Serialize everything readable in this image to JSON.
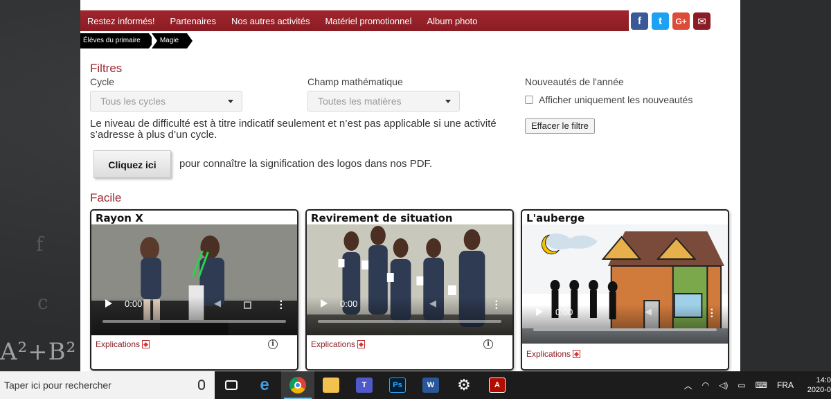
{
  "nav": {
    "items": [
      "Restez informés!",
      "Partenaires",
      "Nos autres activités",
      "Matériel promotionnel",
      "Album photo"
    ]
  },
  "social": {
    "facebook": "f",
    "twitter": "t",
    "google": "G+",
    "mail": "✉"
  },
  "breadcrumb": [
    "Élèves du primaire",
    "Magie"
  ],
  "filters": {
    "title": "Filtres",
    "cycle_label": "Cycle",
    "cycle_value": "Tous les cycles",
    "field_label": "Champ mathématique",
    "field_value": "Toutes les matières",
    "news_label": "Nouveautés de l'année",
    "news_checkbox": "Afficher uniquement les nouveautés",
    "clear_button": "Effacer le filtre",
    "notice": "Le niveau de difficulté est à titre indicatif seulement et n’est pas applicable si une activité s’adresse à plus d’un cycle.",
    "click_button": "Cliquez ici",
    "click_desc": "pour connaître la signification des logos dans nos PDF."
  },
  "section": {
    "title": "Facile"
  },
  "cards": [
    {
      "title": "Rayon X",
      "time": "0:00",
      "link": "Explications",
      "info": "i"
    },
    {
      "title": "Revirement de situation",
      "time": "0:00",
      "link": "Explications",
      "info": "i"
    },
    {
      "title": "L'auberge",
      "time": "0:00",
      "link": "Explications"
    }
  ],
  "taskbar": {
    "search": "Taper ici pour rechercher",
    "apps": [
      "Task View",
      "Edge",
      "Chrome",
      "File Explorer",
      "Teams",
      "Photoshop",
      "Word",
      "Settings",
      "Acrobat"
    ],
    "lang": "FRA",
    "time": "14:0",
    "date": "2020-0"
  },
  "background": {
    "formula": "A²+B²",
    "scribble_f": "f",
    "scribble_c": "c"
  },
  "colors": {
    "brand": "#8a1c24",
    "heading": "#9b2830"
  }
}
